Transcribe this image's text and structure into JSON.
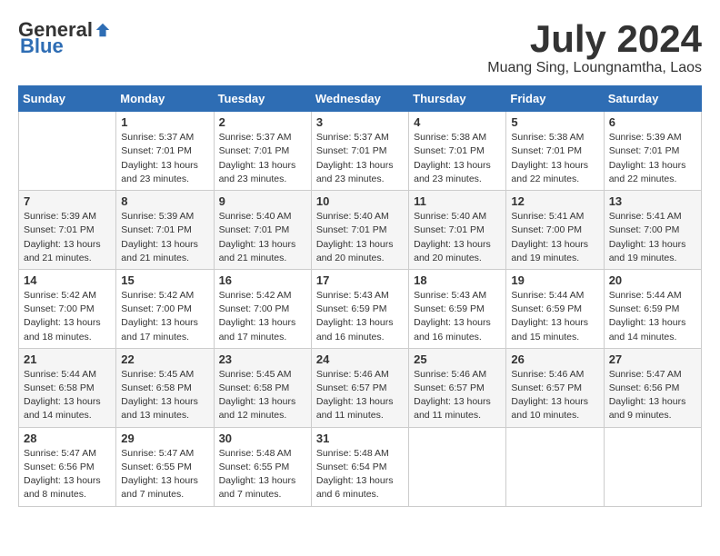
{
  "header": {
    "logo_general": "General",
    "logo_blue": "Blue",
    "month_title": "July 2024",
    "location": "Muang Sing, Loungnamtha, Laos"
  },
  "columns": [
    "Sunday",
    "Monday",
    "Tuesday",
    "Wednesday",
    "Thursday",
    "Friday",
    "Saturday"
  ],
  "weeks": [
    [
      {
        "num": "",
        "info": ""
      },
      {
        "num": "1",
        "info": "Sunrise: 5:37 AM\nSunset: 7:01 PM\nDaylight: 13 hours\nand 23 minutes."
      },
      {
        "num": "2",
        "info": "Sunrise: 5:37 AM\nSunset: 7:01 PM\nDaylight: 13 hours\nand 23 minutes."
      },
      {
        "num": "3",
        "info": "Sunrise: 5:37 AM\nSunset: 7:01 PM\nDaylight: 13 hours\nand 23 minutes."
      },
      {
        "num": "4",
        "info": "Sunrise: 5:38 AM\nSunset: 7:01 PM\nDaylight: 13 hours\nand 23 minutes."
      },
      {
        "num": "5",
        "info": "Sunrise: 5:38 AM\nSunset: 7:01 PM\nDaylight: 13 hours\nand 22 minutes."
      },
      {
        "num": "6",
        "info": "Sunrise: 5:39 AM\nSunset: 7:01 PM\nDaylight: 13 hours\nand 22 minutes."
      }
    ],
    [
      {
        "num": "7",
        "info": "Sunrise: 5:39 AM\nSunset: 7:01 PM\nDaylight: 13 hours\nand 21 minutes."
      },
      {
        "num": "8",
        "info": "Sunrise: 5:39 AM\nSunset: 7:01 PM\nDaylight: 13 hours\nand 21 minutes."
      },
      {
        "num": "9",
        "info": "Sunrise: 5:40 AM\nSunset: 7:01 PM\nDaylight: 13 hours\nand 21 minutes."
      },
      {
        "num": "10",
        "info": "Sunrise: 5:40 AM\nSunset: 7:01 PM\nDaylight: 13 hours\nand 20 minutes."
      },
      {
        "num": "11",
        "info": "Sunrise: 5:40 AM\nSunset: 7:01 PM\nDaylight: 13 hours\nand 20 minutes."
      },
      {
        "num": "12",
        "info": "Sunrise: 5:41 AM\nSunset: 7:00 PM\nDaylight: 13 hours\nand 19 minutes."
      },
      {
        "num": "13",
        "info": "Sunrise: 5:41 AM\nSunset: 7:00 PM\nDaylight: 13 hours\nand 19 minutes."
      }
    ],
    [
      {
        "num": "14",
        "info": "Sunrise: 5:42 AM\nSunset: 7:00 PM\nDaylight: 13 hours\nand 18 minutes."
      },
      {
        "num": "15",
        "info": "Sunrise: 5:42 AM\nSunset: 7:00 PM\nDaylight: 13 hours\nand 17 minutes."
      },
      {
        "num": "16",
        "info": "Sunrise: 5:42 AM\nSunset: 7:00 PM\nDaylight: 13 hours\nand 17 minutes."
      },
      {
        "num": "17",
        "info": "Sunrise: 5:43 AM\nSunset: 6:59 PM\nDaylight: 13 hours\nand 16 minutes."
      },
      {
        "num": "18",
        "info": "Sunrise: 5:43 AM\nSunset: 6:59 PM\nDaylight: 13 hours\nand 16 minutes."
      },
      {
        "num": "19",
        "info": "Sunrise: 5:44 AM\nSunset: 6:59 PM\nDaylight: 13 hours\nand 15 minutes."
      },
      {
        "num": "20",
        "info": "Sunrise: 5:44 AM\nSunset: 6:59 PM\nDaylight: 13 hours\nand 14 minutes."
      }
    ],
    [
      {
        "num": "21",
        "info": "Sunrise: 5:44 AM\nSunset: 6:58 PM\nDaylight: 13 hours\nand 14 minutes."
      },
      {
        "num": "22",
        "info": "Sunrise: 5:45 AM\nSunset: 6:58 PM\nDaylight: 13 hours\nand 13 minutes."
      },
      {
        "num": "23",
        "info": "Sunrise: 5:45 AM\nSunset: 6:58 PM\nDaylight: 13 hours\nand 12 minutes."
      },
      {
        "num": "24",
        "info": "Sunrise: 5:46 AM\nSunset: 6:57 PM\nDaylight: 13 hours\nand 11 minutes."
      },
      {
        "num": "25",
        "info": "Sunrise: 5:46 AM\nSunset: 6:57 PM\nDaylight: 13 hours\nand 11 minutes."
      },
      {
        "num": "26",
        "info": "Sunrise: 5:46 AM\nSunset: 6:57 PM\nDaylight: 13 hours\nand 10 minutes."
      },
      {
        "num": "27",
        "info": "Sunrise: 5:47 AM\nSunset: 6:56 PM\nDaylight: 13 hours\nand 9 minutes."
      }
    ],
    [
      {
        "num": "28",
        "info": "Sunrise: 5:47 AM\nSunset: 6:56 PM\nDaylight: 13 hours\nand 8 minutes."
      },
      {
        "num": "29",
        "info": "Sunrise: 5:47 AM\nSunset: 6:55 PM\nDaylight: 13 hours\nand 7 minutes."
      },
      {
        "num": "30",
        "info": "Sunrise: 5:48 AM\nSunset: 6:55 PM\nDaylight: 13 hours\nand 7 minutes."
      },
      {
        "num": "31",
        "info": "Sunrise: 5:48 AM\nSunset: 6:54 PM\nDaylight: 13 hours\nand 6 minutes."
      },
      {
        "num": "",
        "info": ""
      },
      {
        "num": "",
        "info": ""
      },
      {
        "num": "",
        "info": ""
      }
    ]
  ]
}
